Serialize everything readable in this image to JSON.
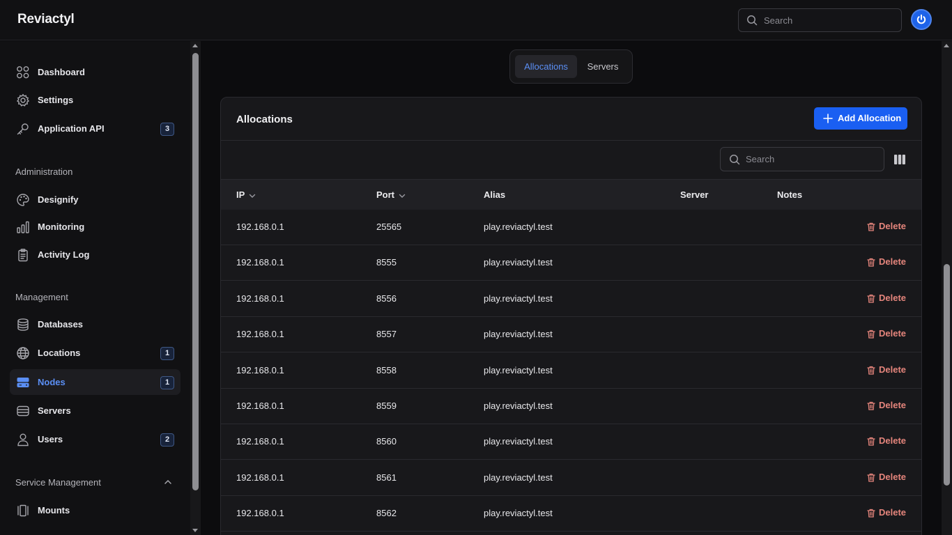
{
  "app": {
    "title": "Reviactyl"
  },
  "header": {
    "search_placeholder": "Search",
    "power_icon": "power-icon"
  },
  "sidebar": {
    "items_top": [
      {
        "label": "Dashboard",
        "icon": "grid-icon"
      },
      {
        "label": "Settings",
        "icon": "gear-icon"
      },
      {
        "label": "Application API",
        "icon": "key-icon",
        "badge": "3"
      }
    ],
    "sections": {
      "administration": "Administration",
      "management": "Management",
      "service_management": "Service Management"
    },
    "items_admin": [
      {
        "label": "Designify",
        "icon": "palette-icon"
      },
      {
        "label": "Monitoring",
        "icon": "bar-chart-icon"
      },
      {
        "label": "Activity Log",
        "icon": "clipboard-icon"
      }
    ],
    "items_management": [
      {
        "label": "Databases",
        "icon": "database-icon"
      },
      {
        "label": "Locations",
        "icon": "globe-icon",
        "badge": "1"
      },
      {
        "label": "Nodes",
        "icon": "server-icon",
        "badge": "1",
        "active": true
      },
      {
        "label": "Servers",
        "icon": "server-stack-icon"
      },
      {
        "label": "Users",
        "icon": "user-icon",
        "badge": "2"
      }
    ],
    "items_service": [
      {
        "label": "Mounts",
        "icon": "mount-icon"
      }
    ]
  },
  "tabs": [
    {
      "label": "Allocations",
      "active": true
    },
    {
      "label": "Servers",
      "active": false
    }
  ],
  "card": {
    "title": "Allocations",
    "add_button": "Add Allocation",
    "search_placeholder": "Search"
  },
  "table": {
    "columns": [
      "IP",
      "Port",
      "Alias",
      "Server",
      "Notes"
    ],
    "delete_label": "Delete",
    "rows": [
      {
        "ip": "192.168.0.1",
        "port": "25565",
        "alias": "play.reviactyl.test",
        "server": "",
        "notes": ""
      },
      {
        "ip": "192.168.0.1",
        "port": "8555",
        "alias": "play.reviactyl.test",
        "server": "",
        "notes": ""
      },
      {
        "ip": "192.168.0.1",
        "port": "8556",
        "alias": "play.reviactyl.test",
        "server": "",
        "notes": ""
      },
      {
        "ip": "192.168.0.1",
        "port": "8557",
        "alias": "play.reviactyl.test",
        "server": "",
        "notes": ""
      },
      {
        "ip": "192.168.0.1",
        "port": "8558",
        "alias": "play.reviactyl.test",
        "server": "",
        "notes": ""
      },
      {
        "ip": "192.168.0.1",
        "port": "8559",
        "alias": "play.reviactyl.test",
        "server": "",
        "notes": ""
      },
      {
        "ip": "192.168.0.1",
        "port": "8560",
        "alias": "play.reviactyl.test",
        "server": "",
        "notes": ""
      },
      {
        "ip": "192.168.0.1",
        "port": "8561",
        "alias": "play.reviactyl.test",
        "server": "",
        "notes": ""
      },
      {
        "ip": "192.168.0.1",
        "port": "8562",
        "alias": "play.reviactyl.test",
        "server": "",
        "notes": ""
      }
    ]
  },
  "colors": {
    "accent": "#1a5ff2",
    "active_text": "#5b8ff5",
    "danger": "#e5857c"
  }
}
